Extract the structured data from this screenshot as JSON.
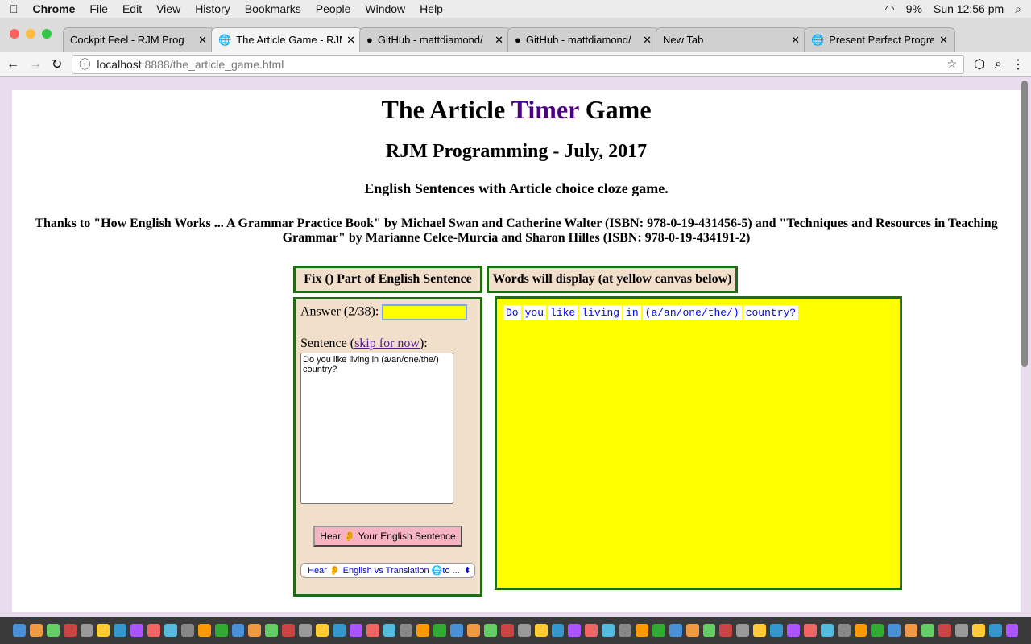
{
  "menubar": {
    "app": "Chrome",
    "items": [
      "File",
      "Edit",
      "View",
      "History",
      "Bookmarks",
      "People",
      "Window",
      "Help"
    ],
    "battery": "9%",
    "clock": "Sun 12:56 pm"
  },
  "tabs": [
    {
      "title": "Cockpit Feel - RJM Prog"
    },
    {
      "title": "The Article Game - RJM",
      "active": true
    },
    {
      "title": "GitHub - mattdiamond/"
    },
    {
      "title": "GitHub - mattdiamond/"
    },
    {
      "title": "New Tab"
    },
    {
      "title": "Present Perfect Progres"
    }
  ],
  "address": {
    "host": "localhost",
    "rest": ":8888/the_article_game.html"
  },
  "page": {
    "title_a": "The Article ",
    "title_b": "Timer",
    "title_c": " Game",
    "subtitle": "RJM Programming - July, 2017",
    "tagline": "English Sentences with Article choice cloze game.",
    "thanks": "Thanks to \"How English Works ... A Grammar Practice Book\" by Michael Swan and Catherine Walter (ISBN: 978-0-19-431456-5) and \"Techniques and Resources in Teaching Grammar\" by Marianne Celce-Murcia and Sharon Hilles (ISBN: 978-0-19-434191-2)"
  },
  "left_header": "Fix () Part of English Sentence",
  "right_header": "Words will display (at yellow canvas below)",
  "form": {
    "answer_label": "Answer (2/38):",
    "answer_value": "",
    "sentence_label": "Sentence (",
    "skip_link": "skip for now",
    "sentence_label_end": "):",
    "sentence": "Do you like living in (a/an/one/the/) country?",
    "hear_button": "Hear 👂 Your English Sentence",
    "translate_select": "Hear 👂 English vs Translation 🌐to ..."
  },
  "canvas_words": [
    "Do",
    "you",
    "like",
    "living",
    "in",
    "(a/an/one/the/)",
    "country?"
  ],
  "colors": {
    "box_border": "#236b12",
    "box_bg": "#f2dfcb",
    "canvas": "#ffff00",
    "timer": "#4b0082"
  }
}
